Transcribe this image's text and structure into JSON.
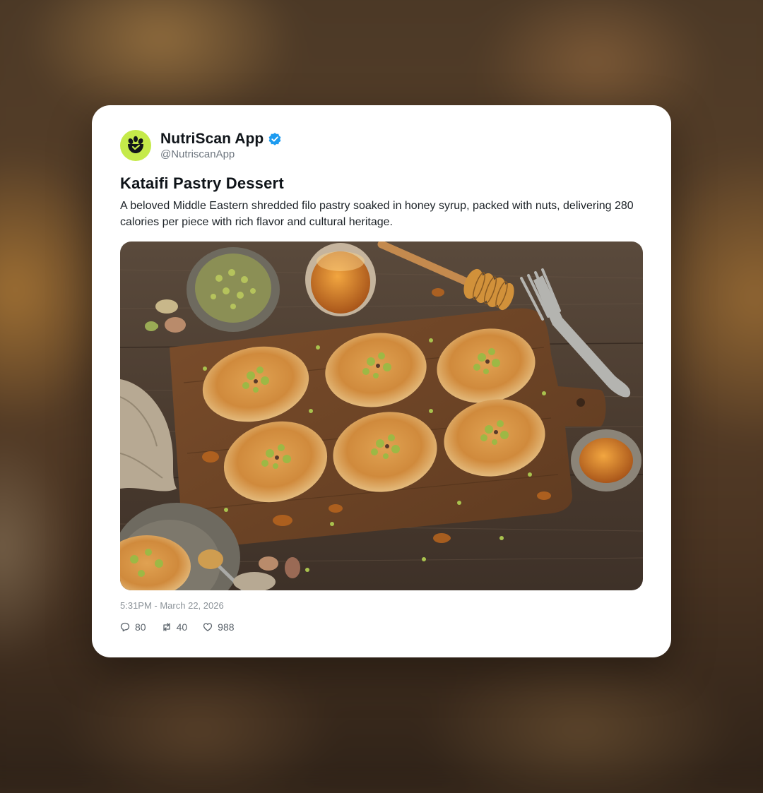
{
  "account": {
    "name": "NutriScan App",
    "handle": "@NutriscanApp",
    "verified": true,
    "avatar_icon": "nutriscan-logo-icon",
    "avatar_color": "#c5ea4a"
  },
  "post": {
    "title": "Kataifi Pastry Dessert",
    "description": "A beloved Middle Eastern shredded filo pastry soaked in honey syrup, packed with nuts, delivering 280 calories per piece with rich flavor and cultural heritage.",
    "timestamp": "5:31PM - March 22, 2026",
    "image_icon": "kataifi-pastry-photo"
  },
  "stats": {
    "replies": "80",
    "reposts": "40",
    "likes": "988"
  },
  "icons": {
    "verified": "verified-badge-icon",
    "reply": "reply-icon",
    "repost": "repost-icon",
    "like": "heart-icon"
  },
  "colors": {
    "verified": "#1d9bf0",
    "card_bg": "#ffffff",
    "text_primary": "#0f1419",
    "text_secondary": "#6f7780"
  }
}
